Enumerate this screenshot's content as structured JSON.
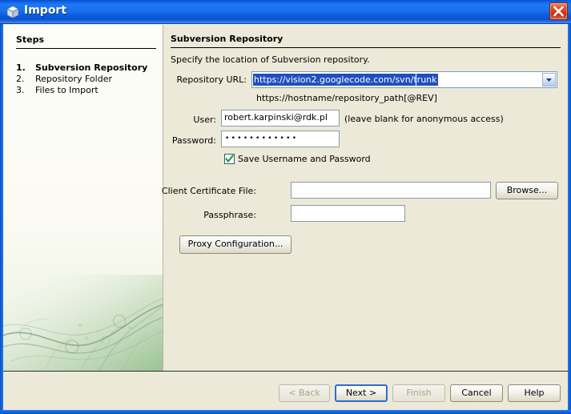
{
  "window": {
    "title": "Import",
    "icon": "cube-icon",
    "close_label": "×"
  },
  "steps_panel": {
    "heading": "Steps",
    "items": [
      {
        "number": "1.",
        "label": "Subversion Repository",
        "active": true
      },
      {
        "number": "2.",
        "label": "Repository Folder",
        "active": false
      },
      {
        "number": "3.",
        "label": "Files to Import",
        "active": false
      }
    ]
  },
  "content": {
    "title": "Subversion Repository",
    "description": "Specify the location of Subversion repository.",
    "repository_url": {
      "label": "Repository URL:",
      "value": "https://vision2.googlecode.com/svn/trunk",
      "selected": true,
      "hint": "https://hostname/repository_path[@REV]",
      "dropdown_icon": "chevron-down-icon"
    },
    "user": {
      "label": "User:",
      "value": "robert.karpinski@rdk.pl",
      "note": "(leave blank for anonymous access)"
    },
    "password": {
      "label": "Password:",
      "value": "••••••••••••"
    },
    "save_credentials": {
      "label": "Save Username and Password",
      "checked": true
    },
    "client_certificate": {
      "label": "Client Certificate File:",
      "value": "",
      "browse_label": "Browse..."
    },
    "passphrase": {
      "label": "Passphrase:",
      "value": ""
    },
    "proxy_button_label": "Proxy Configuration..."
  },
  "footer": {
    "back_label": "< Back",
    "back_enabled": false,
    "next_label": "Next >",
    "next_default": true,
    "finish_label": "Finish",
    "finish_enabled": false,
    "cancel_label": "Cancel",
    "help_label": "Help"
  },
  "colors": {
    "titlebar_blue": "#1870ef",
    "dialog_bg": "#ece9d8",
    "selection_blue": "#1f4fbf",
    "close_red": "#c92d11",
    "check_green": "#1b9b22",
    "steps_panel_bg": "#fbfbf4"
  }
}
